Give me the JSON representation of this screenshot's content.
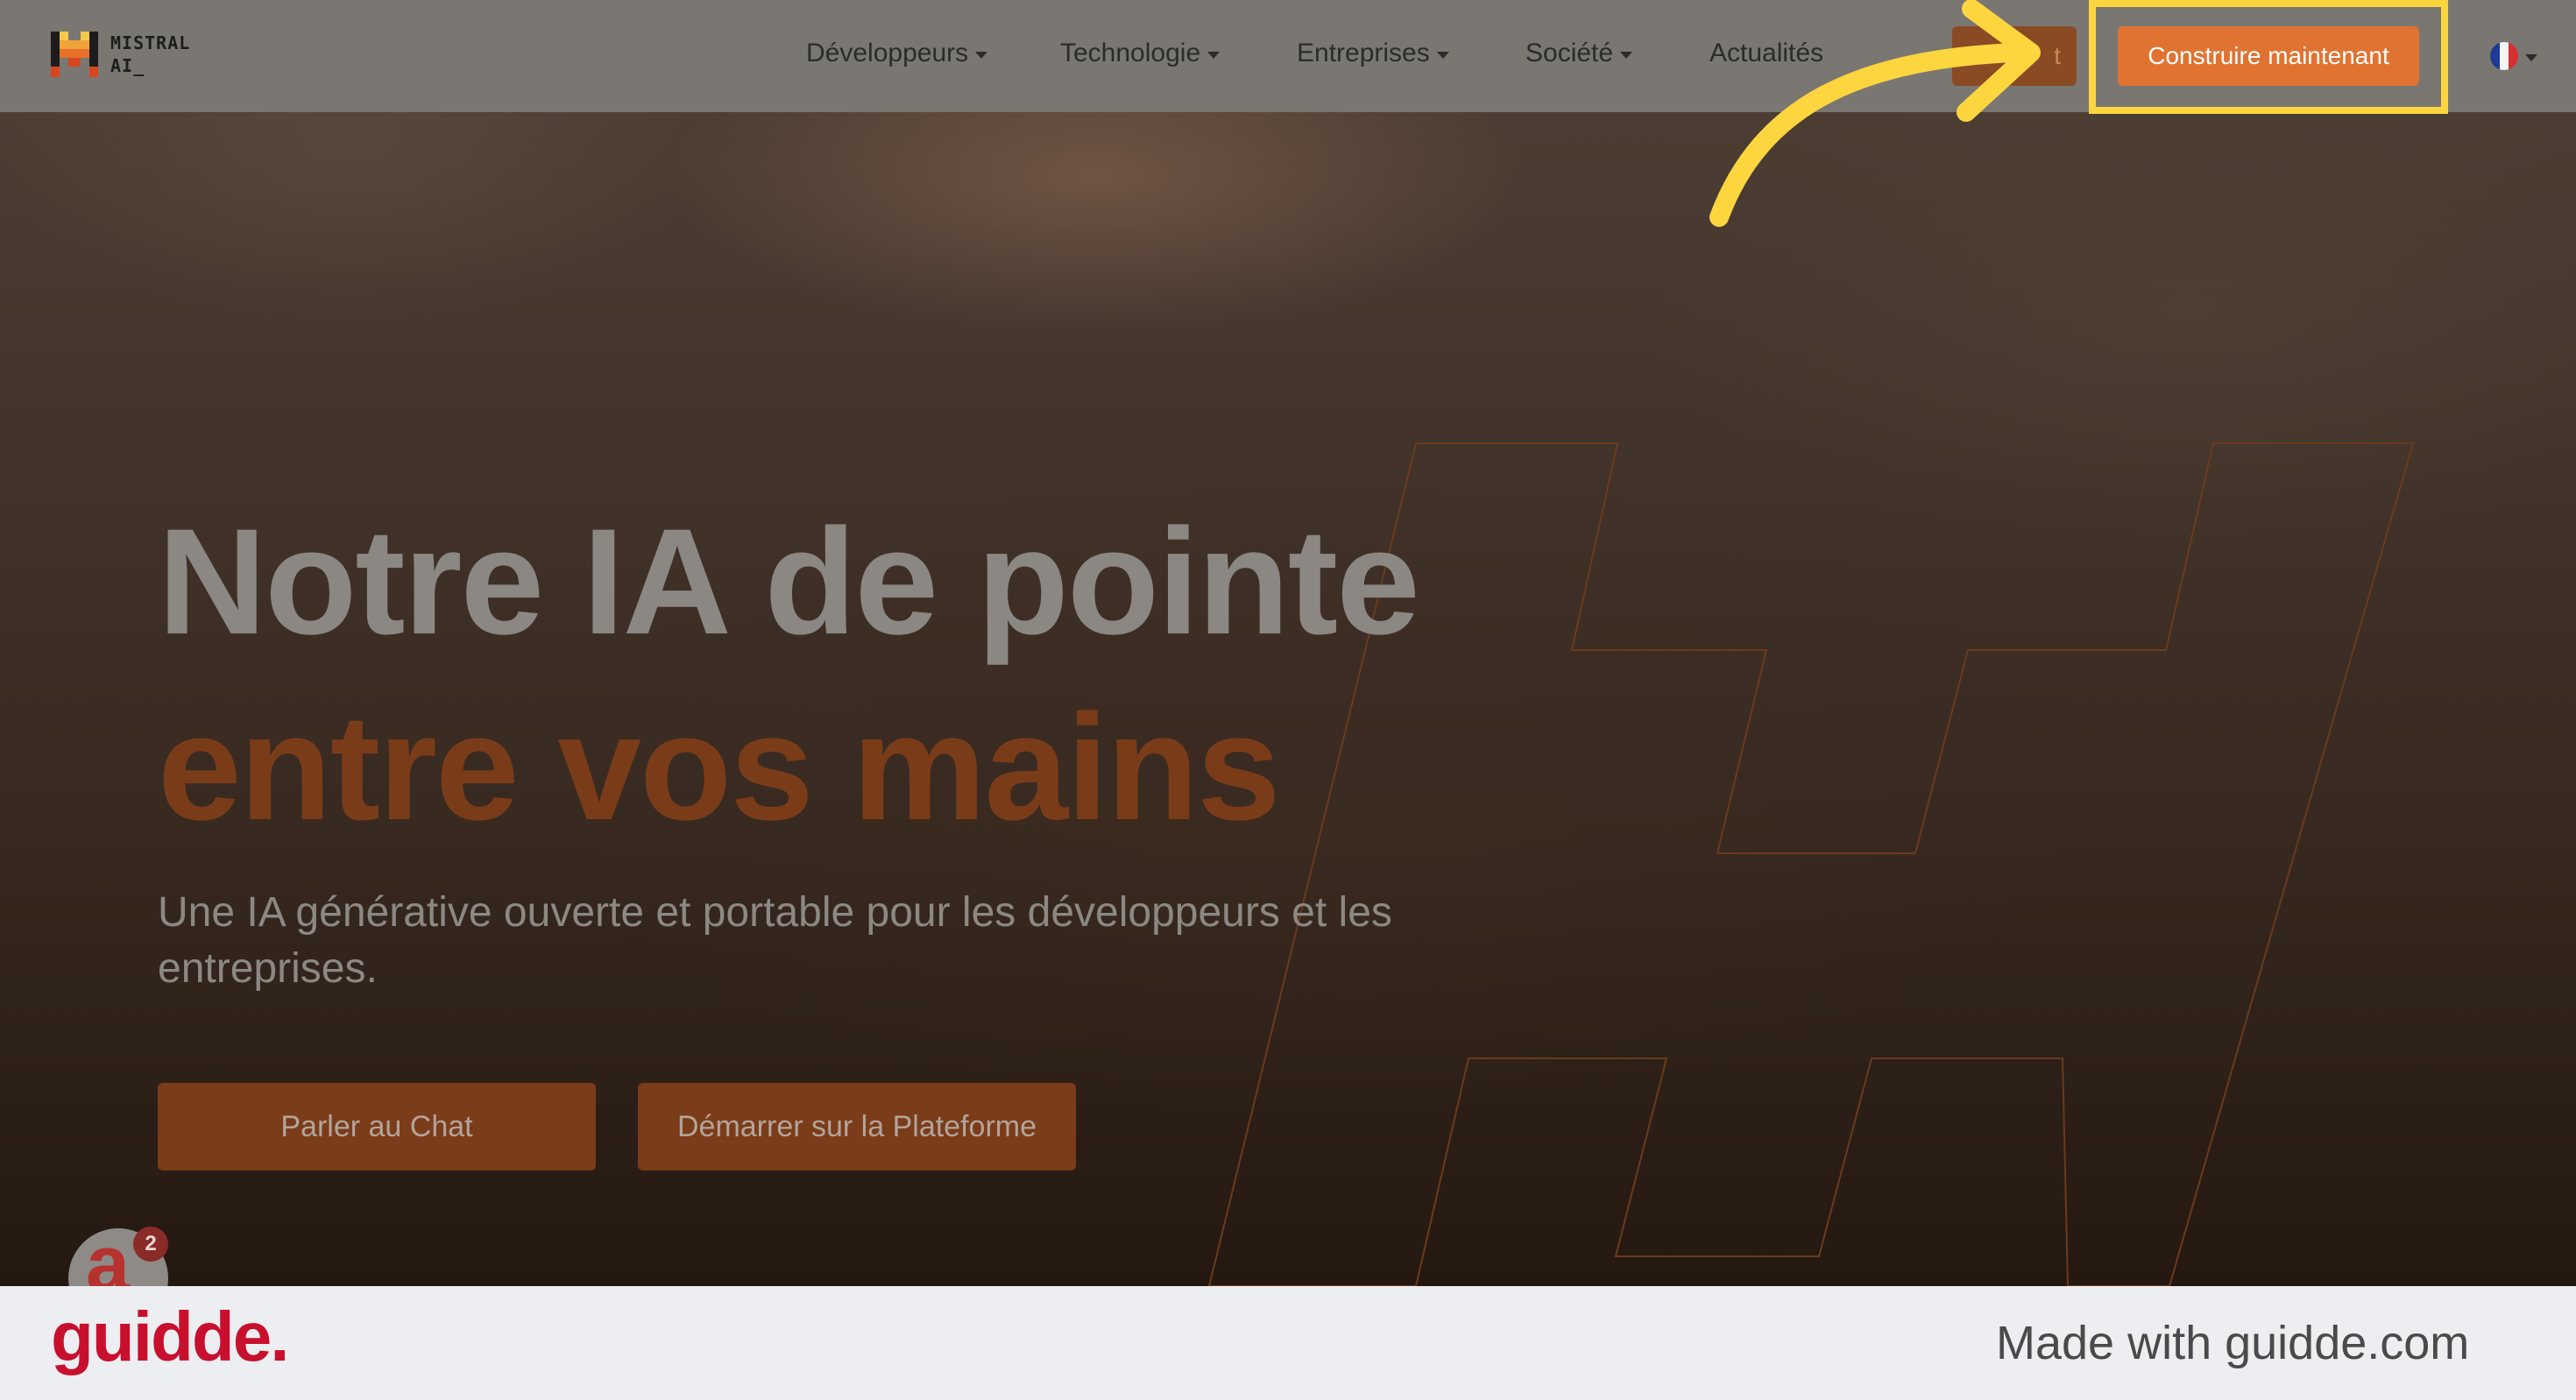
{
  "logo": {
    "line1": "MISTRAL",
    "line2": "AI_"
  },
  "nav": {
    "items": [
      {
        "label": "Développeurs",
        "dropdown": true
      },
      {
        "label": "Technologie",
        "dropdown": true
      },
      {
        "label": "Entreprises",
        "dropdown": true
      },
      {
        "label": "Société",
        "dropdown": true
      },
      {
        "label": "Actualités",
        "dropdown": false
      }
    ],
    "partial_button_label": "t",
    "cta_label": "Construire maintenant",
    "language_icon": "flag-france-icon"
  },
  "hero": {
    "title_line1": "Notre IA de pointe",
    "title_line2": "entre vos mains",
    "subtitle": "Une IA générative ouverte et portable pour les développeurs et les entreprises.",
    "buttons": [
      {
        "label": "Parler au Chat"
      },
      {
        "label": "Démarrer sur la Plateforme"
      }
    ]
  },
  "chat_widget": {
    "icon": "chat-widget-icon",
    "letter": "a",
    "badge_count": "2"
  },
  "footer": {
    "brand": "guidde.",
    "made_with": "Made with guidde.com"
  },
  "colors": {
    "accent_orange": "#e07332",
    "highlight_yellow": "#fcd53f",
    "title_orange": "#7a3c18",
    "guidde_red": "#c8102e"
  }
}
